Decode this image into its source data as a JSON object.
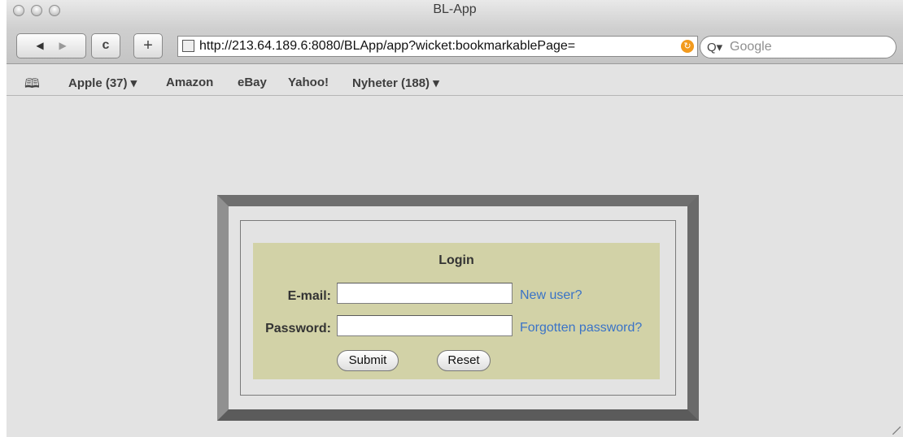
{
  "window": {
    "title": "BL-App"
  },
  "toolbar": {
    "back_icon": "◀",
    "forward_icon": "▶",
    "reload_icon": "c",
    "add_icon": "+",
    "url": "http://213.64.189.6:8080/BLApp/app?wicket:bookmarkablePage=",
    "search_placeholder": "Google"
  },
  "bookmarks": [
    {
      "label": "Apple (37) ▾"
    },
    {
      "label": "Amazon"
    },
    {
      "label": "eBay"
    },
    {
      "label": "Yahoo!"
    },
    {
      "label": "Nyheter (188) ▾"
    }
  ],
  "login": {
    "title": "Login",
    "email_label": "E-mail:",
    "email_value": "",
    "password_label": "Password:",
    "password_value": "",
    "new_user_link": "New user?",
    "forgot_link": "Forgotten password?",
    "submit_label": "Submit",
    "reset_label": "Reset"
  },
  "colors": {
    "panel_bg": "#d2d2a7",
    "link": "#3a73c7",
    "frame": "#7d7d7d"
  }
}
